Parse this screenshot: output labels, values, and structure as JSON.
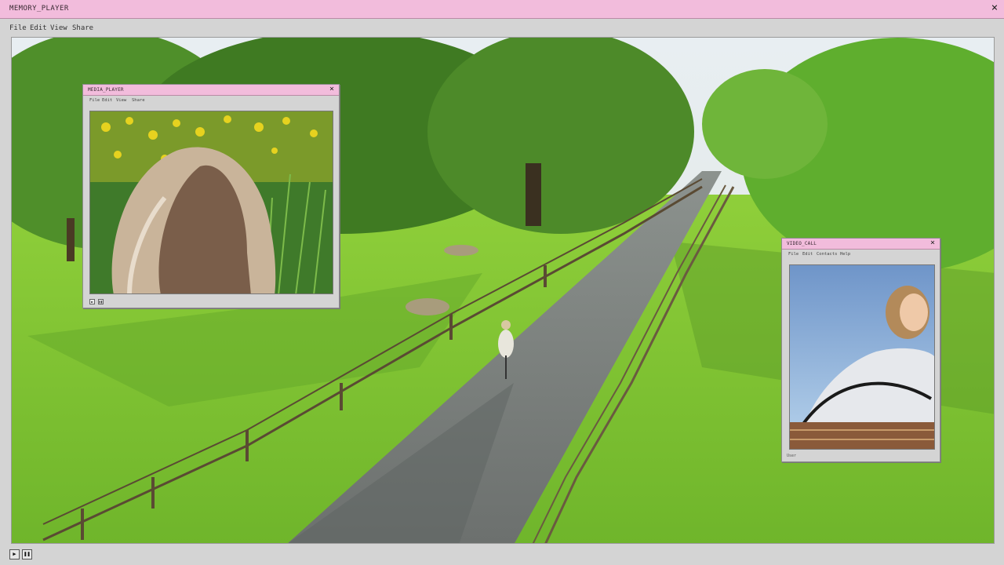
{
  "app": {
    "title": "MEMORY_PLAYER",
    "close_glyph": "×",
    "menu": [
      "File",
      "Edit",
      "View",
      "Share"
    ],
    "controls": {
      "play_icon": "play-icon",
      "pause_icon": "pause-icon"
    },
    "accent_color": "#f2bcdc"
  },
  "media_player": {
    "title": "MEDIA_PLAYER",
    "close_glyph": "×",
    "menu": [
      "File",
      "Edit",
      "View",
      "Share"
    ]
  },
  "video_call": {
    "title": "VIDEO_CALL",
    "close_glyph": "×",
    "menu": [
      "File",
      "Edit",
      "Contacts",
      "Help"
    ],
    "footer_label": "User"
  },
  "glyphs": {
    "play": "▶",
    "pause": "❚❚"
  }
}
